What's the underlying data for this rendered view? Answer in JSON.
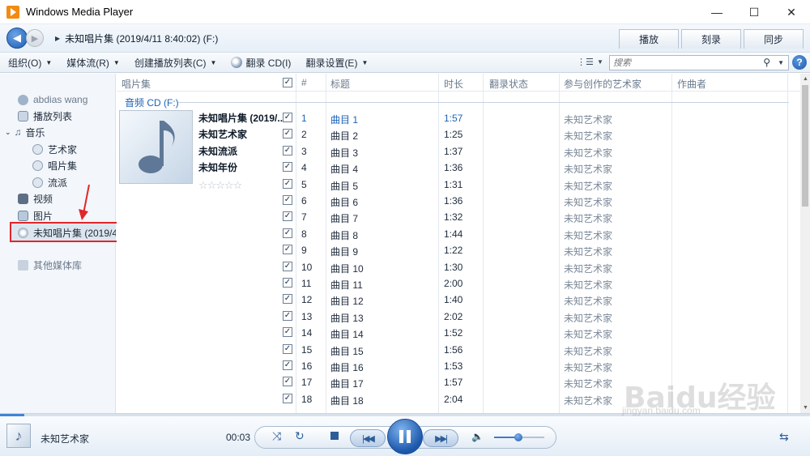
{
  "window": {
    "title": "Windows Media Player",
    "minimize": "—",
    "maximize": "☐",
    "close": "✕"
  },
  "nav": {
    "breadcrumb": "未知唱片集 (2019/4/11 8:40:02) (F:)",
    "tabs": [
      "播放",
      "刻录",
      "同步"
    ]
  },
  "toolbar": {
    "organize": "组织(O)",
    "stream": "媒体流(R)",
    "create_playlist": "创建播放列表(C)",
    "rip_cd": "翻录 CD(I)",
    "rip_settings": "翻录设置(E)",
    "search_placeholder": "搜索"
  },
  "sidebar": {
    "user": "abdias wang",
    "playlists": "播放列表",
    "music": "音乐",
    "artist": "艺术家",
    "album": "唱片集",
    "genre": "流派",
    "video": "视频",
    "pictures": "图片",
    "cd": "未知唱片集 (2019/4",
    "other_libraries": "其他媒体库"
  },
  "columns": {
    "album": "唱片集",
    "number": "#",
    "title": "标题",
    "length": "时长",
    "rip_status": "翻录状态",
    "contributing_artist": "参与创作的艺术家",
    "composer": "作曲者"
  },
  "group": {
    "title": "音频 CD (F:)",
    "album_name": "未知唱片集 (2019/...",
    "album_artist": "未知艺术家",
    "album_genre": "未知流派",
    "album_year": "未知年份",
    "rating": 0
  },
  "tracks": [
    {
      "num": "1",
      "title": "曲目 1",
      "length": "1:57",
      "artist": "未知艺术家",
      "checked": true,
      "playing": true
    },
    {
      "num": "2",
      "title": "曲目 2",
      "length": "1:25",
      "artist": "未知艺术家",
      "checked": true
    },
    {
      "num": "3",
      "title": "曲目 3",
      "length": "1:37",
      "artist": "未知艺术家",
      "checked": true
    },
    {
      "num": "4",
      "title": "曲目 4",
      "length": "1:36",
      "artist": "未知艺术家",
      "checked": true
    },
    {
      "num": "5",
      "title": "曲目 5",
      "length": "1:31",
      "artist": "未知艺术家",
      "checked": true
    },
    {
      "num": "6",
      "title": "曲目 6",
      "length": "1:36",
      "artist": "未知艺术家",
      "checked": true
    },
    {
      "num": "7",
      "title": "曲目 7",
      "length": "1:32",
      "artist": "未知艺术家",
      "checked": true
    },
    {
      "num": "8",
      "title": "曲目 8",
      "length": "1:44",
      "artist": "未知艺术家",
      "checked": true
    },
    {
      "num": "9",
      "title": "曲目 9",
      "length": "1:22",
      "artist": "未知艺术家",
      "checked": true
    },
    {
      "num": "10",
      "title": "曲目 10",
      "length": "1:30",
      "artist": "未知艺术家",
      "checked": true
    },
    {
      "num": "11",
      "title": "曲目 11",
      "length": "2:00",
      "artist": "未知艺术家",
      "checked": true
    },
    {
      "num": "12",
      "title": "曲目 12",
      "length": "1:40",
      "artist": "未知艺术家",
      "checked": true
    },
    {
      "num": "13",
      "title": "曲目 13",
      "length": "2:02",
      "artist": "未知艺术家",
      "checked": true
    },
    {
      "num": "14",
      "title": "曲目 14",
      "length": "1:52",
      "artist": "未知艺术家",
      "checked": true
    },
    {
      "num": "15",
      "title": "曲目 15",
      "length": "1:56",
      "artist": "未知艺术家",
      "checked": true
    },
    {
      "num": "16",
      "title": "曲目 16",
      "length": "1:53",
      "artist": "未知艺术家",
      "checked": true
    },
    {
      "num": "17",
      "title": "曲目 17",
      "length": "1:57",
      "artist": "未知艺术家",
      "checked": true
    },
    {
      "num": "18",
      "title": "曲目 18",
      "length": "2:04",
      "artist": "未知艺术家",
      "checked": true
    }
  ],
  "player": {
    "now_playing_artist": "未知艺术家",
    "elapsed": "00:03",
    "seek_fraction": 0.03,
    "volume_fraction": 0.48
  },
  "watermark": {
    "brand": "Baidu经验",
    "url": "jingyan.baidu.com"
  },
  "colors": {
    "accent": "#1c63b7",
    "highlight_box": "#e0262a",
    "playing_text": "#1c63b7"
  },
  "icons": [
    "back-arrow-icon",
    "forward-arrow-icon",
    "search-icon",
    "help-icon",
    "music-note-icon",
    "pause-icon",
    "previous-icon",
    "next-icon",
    "stop-icon",
    "shuffle-icon",
    "repeat-icon",
    "volume-icon"
  ]
}
